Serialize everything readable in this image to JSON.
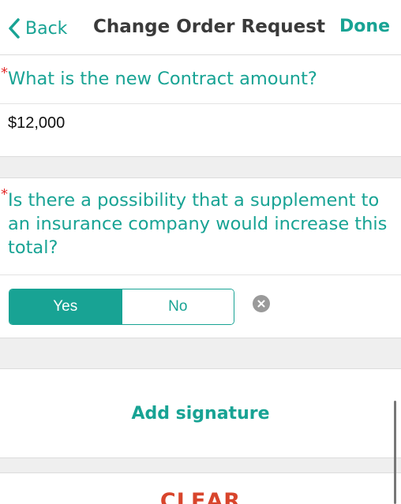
{
  "nav": {
    "back_label": "Back",
    "title": "Change Order Request",
    "done_label": "Done"
  },
  "form": {
    "required_marker": "*",
    "q1": {
      "label": "What is the new Contract amount?",
      "value": "$12,000"
    },
    "q2": {
      "label": "Is there a possibility that a supplement to an insurance company would increase this total?",
      "options": [
        "Yes",
        "No"
      ],
      "selected": "Yes"
    },
    "signature_label": "Add signature",
    "clear_label": "CLEAR"
  },
  "colors": {
    "accent": "#18a394",
    "required": "#e32b2b",
    "clear": "#d8452c"
  },
  "icons": {
    "back": "chevron-left-icon",
    "clear_answer": "close-circle-icon"
  }
}
